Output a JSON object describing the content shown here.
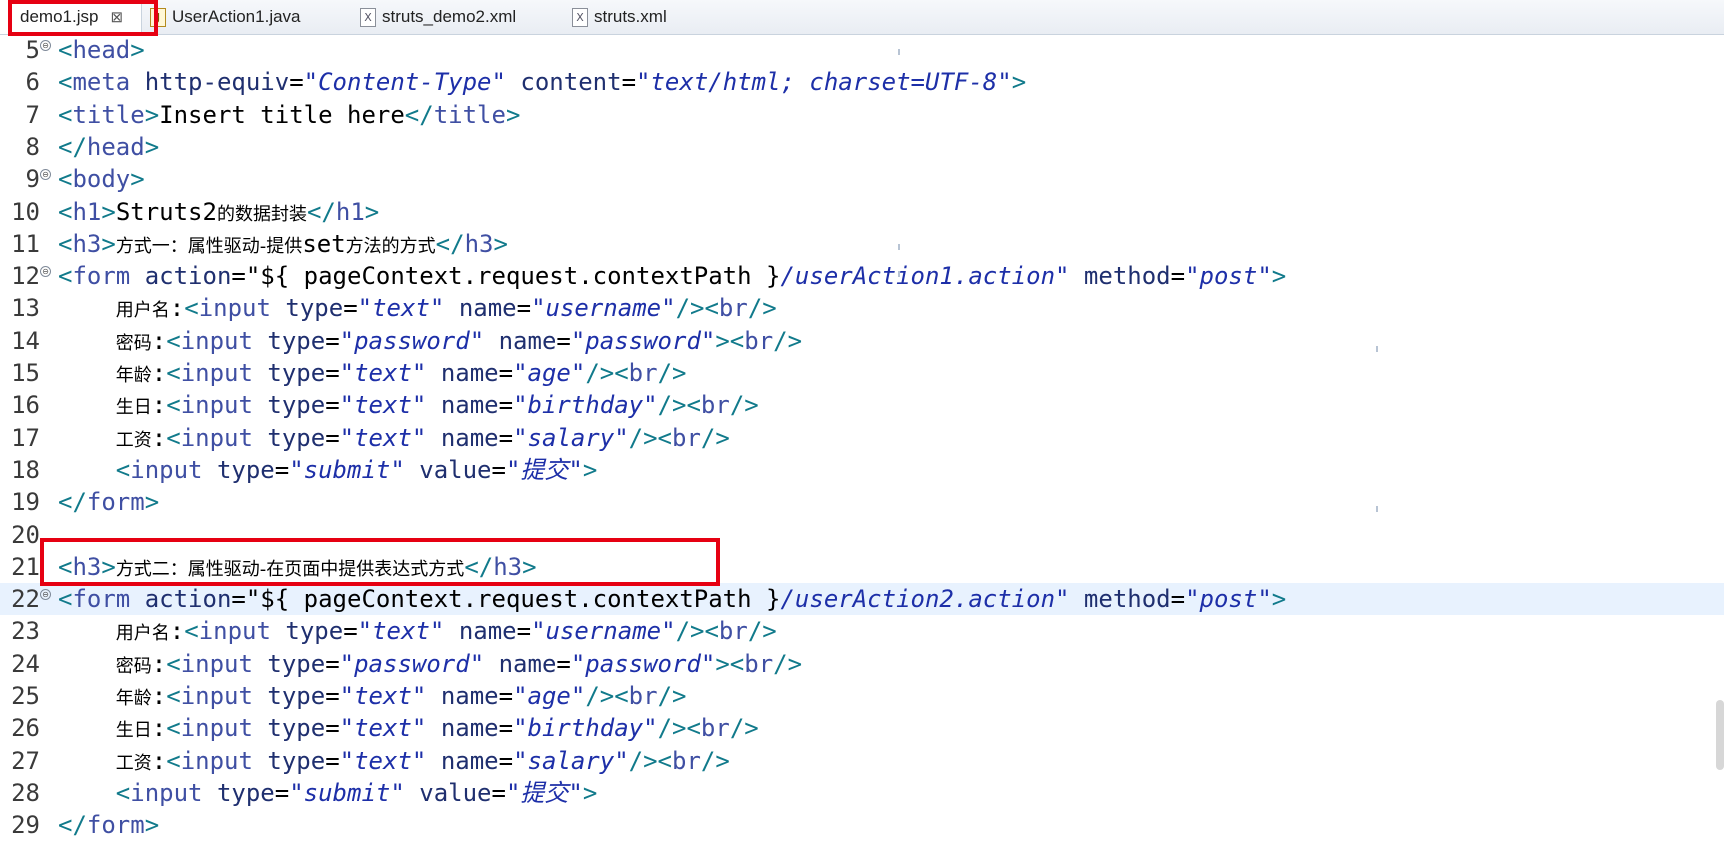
{
  "tabs": [
    {
      "label": "demo1.jsp",
      "icon": "jsp-file-icon",
      "active": true
    },
    {
      "label": "UserAction1.java",
      "icon": "java-file-icon",
      "active": false
    },
    {
      "label": "struts_demo2.xml",
      "icon": "xml-file-icon",
      "active": false
    },
    {
      "label": "struts.xml",
      "icon": "xml-file-icon",
      "active": false
    }
  ],
  "close_glyph": "⊠",
  "fold_glyph": "⊖",
  "colors": {
    "highlight_box": "#e60012",
    "tag": "#117a8b",
    "attr_value": "#1d2fa8",
    "current_line": "#e8f2fe"
  },
  "lines": [
    {
      "n": "5",
      "fold": true,
      "tokens": [
        [
          "t",
          "<"
        ],
        [
          "tn",
          "head"
        ],
        [
          "t",
          ">"
        ]
      ]
    },
    {
      "n": "6",
      "fold": false,
      "tokens": [
        [
          "t",
          "<"
        ],
        [
          "tn",
          "meta"
        ],
        [
          "txt",
          " "
        ],
        [
          "a",
          "http-equiv"
        ],
        [
          "txt",
          "="
        ],
        [
          "v",
          "\"Content-Type\""
        ],
        [
          "txt",
          " "
        ],
        [
          "a",
          "content"
        ],
        [
          "txt",
          "="
        ],
        [
          "v",
          "\"text/html; charset=UTF-8\""
        ],
        [
          "t",
          ">"
        ]
      ]
    },
    {
      "n": "7",
      "fold": false,
      "tokens": [
        [
          "t",
          "<"
        ],
        [
          "tn",
          "title"
        ],
        [
          "t",
          ">"
        ],
        [
          "txt",
          "Insert title here"
        ],
        [
          "t",
          "</"
        ],
        [
          "tn",
          "title"
        ],
        [
          "t",
          ">"
        ]
      ]
    },
    {
      "n": "8",
      "fold": false,
      "tokens": [
        [
          "t",
          "</"
        ],
        [
          "tn",
          "head"
        ],
        [
          "t",
          ">"
        ]
      ]
    },
    {
      "n": "9",
      "fold": true,
      "tokens": [
        [
          "t",
          "<"
        ],
        [
          "tn",
          "body"
        ],
        [
          "t",
          ">"
        ]
      ]
    },
    {
      "n": "10",
      "fold": false,
      "tokens": [
        [
          "t",
          "<"
        ],
        [
          "tn",
          "h1"
        ],
        [
          "t",
          ">"
        ],
        [
          "txt",
          "Struts2"
        ],
        [
          "cjk",
          "的数据封装"
        ],
        [
          "t",
          "</"
        ],
        [
          "tn",
          "h1"
        ],
        [
          "t",
          ">"
        ]
      ]
    },
    {
      "n": "11",
      "fold": false,
      "tokens": [
        [
          "t",
          "<"
        ],
        [
          "tn",
          "h3"
        ],
        [
          "t",
          ">"
        ],
        [
          "cjk",
          "方式一：属性驱动-提供"
        ],
        [
          "txt",
          "set"
        ],
        [
          "cjk",
          "方法的方式"
        ],
        [
          "t",
          "</"
        ],
        [
          "tn",
          "h3"
        ],
        [
          "t",
          ">"
        ]
      ]
    },
    {
      "n": "12",
      "fold": true,
      "tokens": [
        [
          "t",
          "<"
        ],
        [
          "tn",
          "form"
        ],
        [
          "txt",
          " "
        ],
        [
          "a",
          "action"
        ],
        [
          "txt",
          "="
        ],
        [
          "txt",
          "\"${ pageContext.request.contextPath }"
        ],
        [
          "v",
          "/userAction1.action\""
        ],
        [
          "txt",
          " "
        ],
        [
          "a",
          "method"
        ],
        [
          "txt",
          "="
        ],
        [
          "v",
          "\"post\""
        ],
        [
          "t",
          ">"
        ]
      ]
    },
    {
      "n": "13",
      "fold": false,
      "tokens": [
        [
          "txt",
          "    "
        ],
        [
          "cjk",
          "用户名"
        ],
        [
          "txt",
          ":"
        ],
        [
          "t",
          "<"
        ],
        [
          "tn",
          "input"
        ],
        [
          "txt",
          " "
        ],
        [
          "a",
          "type"
        ],
        [
          "txt",
          "="
        ],
        [
          "v",
          "\"text\""
        ],
        [
          "txt",
          " "
        ],
        [
          "a",
          "name"
        ],
        [
          "txt",
          "="
        ],
        [
          "v",
          "\"username\""
        ],
        [
          "t",
          "/><"
        ],
        [
          "tn",
          "br"
        ],
        [
          "t",
          "/>"
        ]
      ]
    },
    {
      "n": "14",
      "fold": false,
      "tokens": [
        [
          "txt",
          "    "
        ],
        [
          "cjk",
          "密码"
        ],
        [
          "txt",
          ":"
        ],
        [
          "t",
          "<"
        ],
        [
          "tn",
          "input"
        ],
        [
          "txt",
          " "
        ],
        [
          "a",
          "type"
        ],
        [
          "txt",
          "="
        ],
        [
          "v",
          "\"password\""
        ],
        [
          "txt",
          " "
        ],
        [
          "a",
          "name"
        ],
        [
          "txt",
          "="
        ],
        [
          "v",
          "\"password\""
        ],
        [
          "t",
          "><"
        ],
        [
          "tn",
          "br"
        ],
        [
          "t",
          "/>"
        ]
      ]
    },
    {
      "n": "15",
      "fold": false,
      "tokens": [
        [
          "txt",
          "    "
        ],
        [
          "cjk",
          "年龄"
        ],
        [
          "txt",
          ":"
        ],
        [
          "t",
          "<"
        ],
        [
          "tn",
          "input"
        ],
        [
          "txt",
          " "
        ],
        [
          "a",
          "type"
        ],
        [
          "txt",
          "="
        ],
        [
          "v",
          "\"text\""
        ],
        [
          "txt",
          " "
        ],
        [
          "a",
          "name"
        ],
        [
          "txt",
          "="
        ],
        [
          "v",
          "\"age\""
        ],
        [
          "t",
          "/><"
        ],
        [
          "tn",
          "br"
        ],
        [
          "t",
          "/>"
        ]
      ]
    },
    {
      "n": "16",
      "fold": false,
      "tokens": [
        [
          "txt",
          "    "
        ],
        [
          "cjk",
          "生日"
        ],
        [
          "txt",
          ":"
        ],
        [
          "t",
          "<"
        ],
        [
          "tn",
          "input"
        ],
        [
          "txt",
          " "
        ],
        [
          "a",
          "type"
        ],
        [
          "txt",
          "="
        ],
        [
          "v",
          "\"text\""
        ],
        [
          "txt",
          " "
        ],
        [
          "a",
          "name"
        ],
        [
          "txt",
          "="
        ],
        [
          "v",
          "\"birthday\""
        ],
        [
          "t",
          "/><"
        ],
        [
          "tn",
          "br"
        ],
        [
          "t",
          "/>"
        ]
      ]
    },
    {
      "n": "17",
      "fold": false,
      "tokens": [
        [
          "txt",
          "    "
        ],
        [
          "cjk",
          "工资"
        ],
        [
          "txt",
          ":"
        ],
        [
          "t",
          "<"
        ],
        [
          "tn",
          "input"
        ],
        [
          "txt",
          " "
        ],
        [
          "a",
          "type"
        ],
        [
          "txt",
          "="
        ],
        [
          "v",
          "\"text\""
        ],
        [
          "txt",
          " "
        ],
        [
          "a",
          "name"
        ],
        [
          "txt",
          "="
        ],
        [
          "v",
          "\"salary\""
        ],
        [
          "t",
          "/><"
        ],
        [
          "tn",
          "br"
        ],
        [
          "t",
          "/>"
        ]
      ]
    },
    {
      "n": "18",
      "fold": false,
      "tokens": [
        [
          "txt",
          "    "
        ],
        [
          "t",
          "<"
        ],
        [
          "tn",
          "input"
        ],
        [
          "txt",
          " "
        ],
        [
          "a",
          "type"
        ],
        [
          "txt",
          "="
        ],
        [
          "v",
          "\"submit\""
        ],
        [
          "txt",
          " "
        ],
        [
          "a",
          "value"
        ],
        [
          "txt",
          "="
        ],
        [
          "v",
          "\"提交\""
        ],
        [
          "t",
          ">"
        ]
      ]
    },
    {
      "n": "19",
      "fold": false,
      "tokens": [
        [
          "t",
          "</"
        ],
        [
          "tn",
          "form"
        ],
        [
          "t",
          ">"
        ]
      ]
    },
    {
      "n": "20",
      "fold": false,
      "tokens": []
    },
    {
      "n": "21",
      "fold": false,
      "tokens": [
        [
          "t",
          "<"
        ],
        [
          "tn",
          "h3"
        ],
        [
          "t",
          ">"
        ],
        [
          "cjk",
          "方式二：属性驱动-在页面中提供表达式方式"
        ],
        [
          "t",
          "</"
        ],
        [
          "tn",
          "h3"
        ],
        [
          "t",
          ">"
        ]
      ]
    },
    {
      "n": "22",
      "fold": true,
      "current": true,
      "tokens": [
        [
          "t",
          "<"
        ],
        [
          "tn",
          "form"
        ],
        [
          "txt",
          " "
        ],
        [
          "a",
          "action"
        ],
        [
          "txt",
          "="
        ],
        [
          "txt",
          "\"${ pageContext.request.contextPath }"
        ],
        [
          "v",
          "/userAction2.action\""
        ],
        [
          "txt",
          " "
        ],
        [
          "a",
          "method"
        ],
        [
          "txt",
          "="
        ],
        [
          "v",
          "\"post\""
        ],
        [
          "t",
          ">"
        ]
      ]
    },
    {
      "n": "23",
      "fold": false,
      "tokens": [
        [
          "txt",
          "    "
        ],
        [
          "cjk",
          "用户名"
        ],
        [
          "txt",
          ":"
        ],
        [
          "t",
          "<"
        ],
        [
          "tn",
          "input"
        ],
        [
          "txt",
          " "
        ],
        [
          "a",
          "type"
        ],
        [
          "txt",
          "="
        ],
        [
          "v",
          "\"text\""
        ],
        [
          "txt",
          " "
        ],
        [
          "a",
          "name"
        ],
        [
          "txt",
          "="
        ],
        [
          "v",
          "\"username\""
        ],
        [
          "t",
          "/><"
        ],
        [
          "tn",
          "br"
        ],
        [
          "t",
          "/>"
        ]
      ]
    },
    {
      "n": "24",
      "fold": false,
      "tokens": [
        [
          "txt",
          "    "
        ],
        [
          "cjk",
          "密码"
        ],
        [
          "txt",
          ":"
        ],
        [
          "t",
          "<"
        ],
        [
          "tn",
          "input"
        ],
        [
          "txt",
          " "
        ],
        [
          "a",
          "type"
        ],
        [
          "txt",
          "="
        ],
        [
          "v",
          "\"password\""
        ],
        [
          "txt",
          " "
        ],
        [
          "a",
          "name"
        ],
        [
          "txt",
          "="
        ],
        [
          "v",
          "\"password\""
        ],
        [
          "t",
          "><"
        ],
        [
          "tn",
          "br"
        ],
        [
          "t",
          "/>"
        ]
      ]
    },
    {
      "n": "25",
      "fold": false,
      "tokens": [
        [
          "txt",
          "    "
        ],
        [
          "cjk",
          "年龄"
        ],
        [
          "txt",
          ":"
        ],
        [
          "t",
          "<"
        ],
        [
          "tn",
          "input"
        ],
        [
          "txt",
          " "
        ],
        [
          "a",
          "type"
        ],
        [
          "txt",
          "="
        ],
        [
          "v",
          "\"text\""
        ],
        [
          "txt",
          " "
        ],
        [
          "a",
          "name"
        ],
        [
          "txt",
          "="
        ],
        [
          "v",
          "\"age\""
        ],
        [
          "t",
          "/><"
        ],
        [
          "tn",
          "br"
        ],
        [
          "t",
          "/>"
        ]
      ]
    },
    {
      "n": "26",
      "fold": false,
      "tokens": [
        [
          "txt",
          "    "
        ],
        [
          "cjk",
          "生日"
        ],
        [
          "txt",
          ":"
        ],
        [
          "t",
          "<"
        ],
        [
          "tn",
          "input"
        ],
        [
          "txt",
          " "
        ],
        [
          "a",
          "type"
        ],
        [
          "txt",
          "="
        ],
        [
          "v",
          "\"text\""
        ],
        [
          "txt",
          " "
        ],
        [
          "a",
          "name"
        ],
        [
          "txt",
          "="
        ],
        [
          "v",
          "\"birthday\""
        ],
        [
          "t",
          "/><"
        ],
        [
          "tn",
          "br"
        ],
        [
          "t",
          "/>"
        ]
      ]
    },
    {
      "n": "27",
      "fold": false,
      "tokens": [
        [
          "txt",
          "    "
        ],
        [
          "cjk",
          "工资"
        ],
        [
          "txt",
          ":"
        ],
        [
          "t",
          "<"
        ],
        [
          "tn",
          "input"
        ],
        [
          "txt",
          " "
        ],
        [
          "a",
          "type"
        ],
        [
          "txt",
          "="
        ],
        [
          "v",
          "\"text\""
        ],
        [
          "txt",
          " "
        ],
        [
          "a",
          "name"
        ],
        [
          "txt",
          "="
        ],
        [
          "v",
          "\"salary\""
        ],
        [
          "t",
          "/><"
        ],
        [
          "tn",
          "br"
        ],
        [
          "t",
          "/>"
        ]
      ]
    },
    {
      "n": "28",
      "fold": false,
      "tokens": [
        [
          "txt",
          "    "
        ],
        [
          "t",
          "<"
        ],
        [
          "tn",
          "input"
        ],
        [
          "txt",
          " "
        ],
        [
          "a",
          "type"
        ],
        [
          "txt",
          "="
        ],
        [
          "v",
          "\"submit\""
        ],
        [
          "txt",
          " "
        ],
        [
          "a",
          "value"
        ],
        [
          "txt",
          "="
        ],
        [
          "v",
          "\"提交\""
        ],
        [
          "t",
          ">"
        ]
      ]
    },
    {
      "n": "29",
      "fold": false,
      "tokens": [
        [
          "t",
          "</"
        ],
        [
          "tn",
          "form"
        ],
        [
          "t",
          ">"
        ]
      ]
    }
  ]
}
